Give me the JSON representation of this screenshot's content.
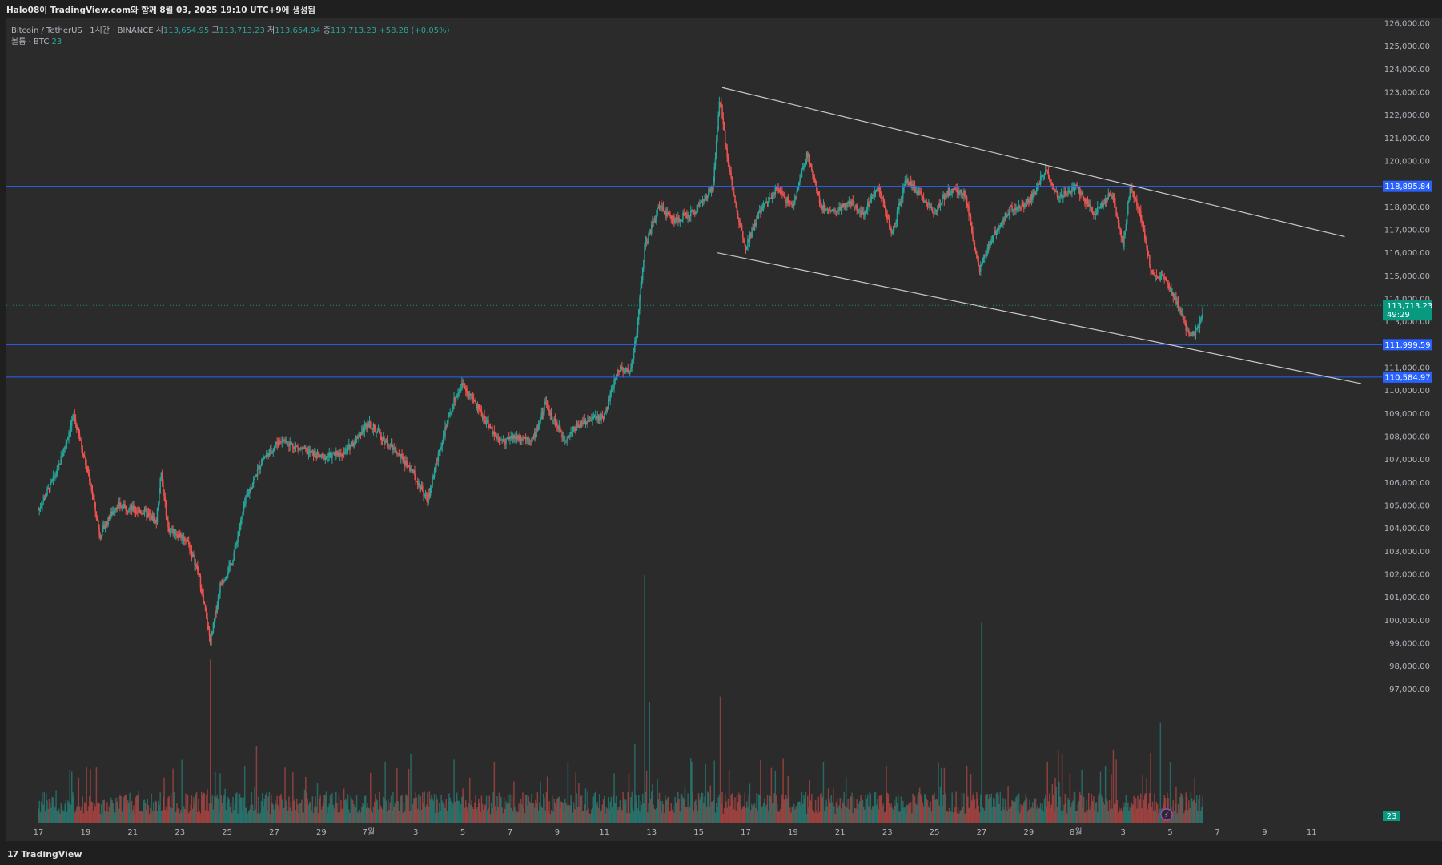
{
  "header": {
    "caption": "Halo08이 TradingView.com와 함께 8월 03, 2025 19:10 UTC+9에 생성됨"
  },
  "legend": {
    "symbol": "Bitcoin / TetherUS · 1시간 · BINANCE",
    "o_label": "시",
    "o_value": "113,654.95",
    "h_label": "고",
    "h_value": "113,713.23",
    "l_label": "저",
    "l_value": "113,654.94",
    "c_label": "종",
    "c_value": "113,713.23",
    "change": "+58.28 (+0.05%)",
    "volume_label": "볼륨 · BTC",
    "volume_value": "23"
  },
  "footer": {
    "brand_logo": "17",
    "brand": "TradingView"
  },
  "colors": {
    "background": "#2b2b2b",
    "up": "#26a69a",
    "down": "#ef5350",
    "hline": "#2962ff",
    "trendline": "#c8c8c8",
    "price_badge": "#089981",
    "level_badge": "#2962ff"
  },
  "chart_data": {
    "type": "candlestick",
    "symbol": "BTCUSDT",
    "interval": "1시간",
    "exchange": "BINANCE",
    "ylim": [
      96000,
      126500
    ],
    "y_ticks": [
      97000,
      98000,
      99000,
      100000,
      101000,
      102000,
      103000,
      104000,
      105000,
      106000,
      107000,
      108000,
      109000,
      110000,
      111000,
      112000,
      113000,
      114000,
      115000,
      116000,
      117000,
      118000,
      119000,
      120000,
      121000,
      122000,
      123000,
      124000,
      125000,
      126000
    ],
    "x_tick_labels": [
      "17",
      "19",
      "21",
      "23",
      "25",
      "27",
      "29",
      "7월",
      "3",
      "5",
      "7",
      "9",
      "11",
      "13",
      "15",
      "17",
      "19",
      "21",
      "23",
      "25",
      "27",
      "29",
      "8월",
      "3",
      "5",
      "7",
      "9",
      "11"
    ],
    "price_path": [
      {
        "day": 0,
        "price": 104800
      },
      {
        "day": 0.8,
        "price": 106500
      },
      {
        "day": 1.5,
        "price": 108900
      },
      {
        "day": 2.2,
        "price": 106000
      },
      {
        "day": 2.6,
        "price": 103700
      },
      {
        "day": 3.3,
        "price": 105000
      },
      {
        "day": 4.5,
        "price": 104700
      },
      {
        "day": 5.0,
        "price": 104300
      },
      {
        "day": 5.2,
        "price": 106400
      },
      {
        "day": 5.5,
        "price": 104000
      },
      {
        "day": 6.3,
        "price": 103500
      },
      {
        "day": 6.8,
        "price": 102000
      },
      {
        "day": 7.3,
        "price": 99000
      },
      {
        "day": 7.7,
        "price": 101500
      },
      {
        "day": 8.2,
        "price": 102500
      },
      {
        "day": 8.8,
        "price": 105300
      },
      {
        "day": 9.5,
        "price": 107000
      },
      {
        "day": 10.3,
        "price": 107900
      },
      {
        "day": 11.0,
        "price": 107500
      },
      {
        "day": 12.0,
        "price": 107100
      },
      {
        "day": 13.0,
        "price": 107300
      },
      {
        "day": 14.0,
        "price": 108600
      },
      {
        "day": 15.0,
        "price": 107500
      },
      {
        "day": 15.8,
        "price": 106600
      },
      {
        "day": 16.5,
        "price": 105200
      },
      {
        "day": 17.0,
        "price": 107400
      },
      {
        "day": 17.6,
        "price": 109500
      },
      {
        "day": 18.0,
        "price": 110300
      },
      {
        "day": 18.6,
        "price": 109300
      },
      {
        "day": 19.2,
        "price": 108300
      },
      {
        "day": 19.6,
        "price": 107800
      },
      {
        "day": 20.3,
        "price": 108000
      },
      {
        "day": 21.0,
        "price": 107900
      },
      {
        "day": 21.5,
        "price": 109400
      },
      {
        "day": 22.3,
        "price": 107900
      },
      {
        "day": 23.0,
        "price": 108600
      },
      {
        "day": 24.0,
        "price": 108900
      },
      {
        "day": 24.6,
        "price": 111000
      },
      {
        "day": 25.1,
        "price": 110800
      },
      {
        "day": 25.4,
        "price": 112800
      },
      {
        "day": 25.7,
        "price": 116200
      },
      {
        "day": 26.3,
        "price": 118000
      },
      {
        "day": 27.0,
        "price": 117400
      },
      {
        "day": 27.8,
        "price": 117800
      },
      {
        "day": 28.6,
        "price": 118800
      },
      {
        "day": 28.9,
        "price": 122800
      },
      {
        "day": 29.2,
        "price": 120300
      },
      {
        "day": 29.6,
        "price": 117800
      },
      {
        "day": 30.0,
        "price": 116300
      },
      {
        "day": 30.6,
        "price": 117800
      },
      {
        "day": 31.3,
        "price": 118800
      },
      {
        "day": 32.0,
        "price": 118000
      },
      {
        "day": 32.6,
        "price": 120400
      },
      {
        "day": 33.2,
        "price": 118000
      },
      {
        "day": 33.8,
        "price": 117800
      },
      {
        "day": 34.4,
        "price": 118200
      },
      {
        "day": 35.0,
        "price": 117700
      },
      {
        "day": 35.6,
        "price": 119000
      },
      {
        "day": 36.2,
        "price": 116800
      },
      {
        "day": 36.8,
        "price": 119200
      },
      {
        "day": 37.4,
        "price": 118500
      },
      {
        "day": 38.0,
        "price": 117800
      },
      {
        "day": 38.6,
        "price": 118700
      },
      {
        "day": 39.3,
        "price": 118600
      },
      {
        "day": 39.9,
        "price": 115200
      },
      {
        "day": 40.5,
        "price": 116800
      },
      {
        "day": 41.2,
        "price": 117900
      },
      {
        "day": 42.0,
        "price": 118200
      },
      {
        "day": 42.7,
        "price": 119600
      },
      {
        "day": 43.3,
        "price": 118400
      },
      {
        "day": 44.0,
        "price": 118900
      },
      {
        "day": 44.8,
        "price": 117700
      },
      {
        "day": 45.5,
        "price": 118600
      },
      {
        "day": 46.0,
        "price": 116400
      },
      {
        "day": 46.3,
        "price": 118800
      },
      {
        "day": 46.7,
        "price": 117800
      },
      {
        "day": 47.2,
        "price": 115200
      },
      {
        "day": 47.8,
        "price": 114800
      },
      {
        "day": 48.3,
        "price": 113800
      },
      {
        "day": 48.8,
        "price": 112400
      },
      {
        "day": 49.2,
        "price": 112700
      },
      {
        "day": 49.4,
        "price": 113713
      }
    ],
    "volume_max_btc": 5000,
    "volume_spikes": [
      {
        "day": 7.3,
        "volume": 3100
      },
      {
        "day": 25.3,
        "volume": 1500
      },
      {
        "day": 25.7,
        "volume": 4700
      },
      {
        "day": 25.9,
        "volume": 2300
      },
      {
        "day": 28.9,
        "volume": 2400
      },
      {
        "day": 40.0,
        "volume": 3800
      },
      {
        "day": 47.6,
        "volume": 1900
      }
    ],
    "horizontal_levels": [
      {
        "price": 118895.84,
        "label": "118,895.84"
      },
      {
        "price": 111999.59,
        "label": "111,999.59"
      },
      {
        "price": 110584.97,
        "label": "110,584.97"
      }
    ],
    "current_price": {
      "label": "113,713.23",
      "countdown": "49:29"
    },
    "volume_badge": "23",
    "trendlines": [
      {
        "from": {
          "day": 29.0,
          "price": 123200
        },
        "to": {
          "day": 55.4,
          "price": 116700
        }
      },
      {
        "from": {
          "day": 28.8,
          "price": 116000
        },
        "to": {
          "day": 56.1,
          "price": 110300
        }
      }
    ]
  }
}
